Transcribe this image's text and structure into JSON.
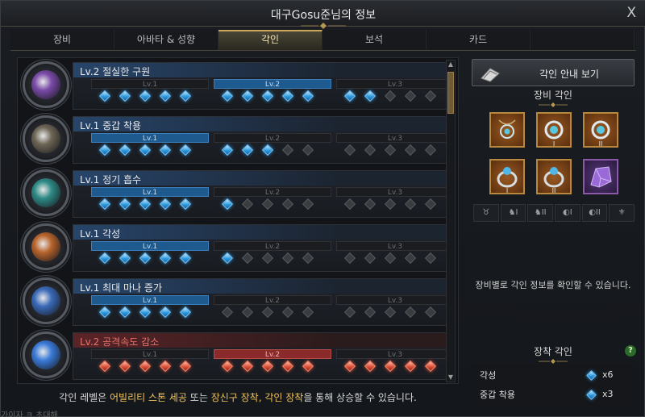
{
  "window": {
    "title": "대구Gosu준님의 정보",
    "close_label": "X"
  },
  "tabs": [
    {
      "label": "장비",
      "active": false
    },
    {
      "label": "아바타 & 성향",
      "active": false
    },
    {
      "label": "각인",
      "active": true
    },
    {
      "label": "보석",
      "active": false
    },
    {
      "label": "카드",
      "active": false
    },
    {
      "label": "",
      "active": false
    }
  ],
  "engravings": [
    {
      "name": "Lv.2 절실한 구원",
      "level": 2,
      "negative": false,
      "icon_color": "#7a4aa8",
      "gems": [
        5,
        5,
        2
      ]
    },
    {
      "name": "Lv.1 중갑 착용",
      "level": 1,
      "negative": false,
      "icon_color": "#6e6656",
      "gems": [
        5,
        3,
        0
      ]
    },
    {
      "name": "Lv.1 정기 흡수",
      "level": 1,
      "negative": false,
      "icon_color": "#2e8a86",
      "gems": [
        5,
        1,
        0
      ]
    },
    {
      "name": "Lv.1 각성",
      "level": 1,
      "negative": false,
      "icon_color": "#b8642c",
      "gems": [
        5,
        1,
        0
      ]
    },
    {
      "name": "Lv.1 최대 마나 증가",
      "level": 1,
      "negative": false,
      "icon_color": "#3a6ab8",
      "gems": [
        5,
        0,
        0
      ]
    },
    {
      "name": "Lv.2 공격속도 감소",
      "level": 2,
      "negative": true,
      "icon_color": "#3a7ad8",
      "gems": [
        5,
        5,
        5
      ]
    }
  ],
  "level_labels": [
    "Lv.1",
    "Lv.2",
    "Lv.3"
  ],
  "footer": {
    "prefix": "각인 레벨은 ",
    "h1": "어빌리티 스톤 세공",
    "mid": " 또는 ",
    "h2": "장신구 장착, 각인 장착",
    "suffix": "을 통해 상승할 수 있습니다."
  },
  "right": {
    "guide_button": "각인 안내 보기",
    "equip_title": "장비 각인",
    "info_text": "장비별로 각인 정보를 확인할 수 있습니다.",
    "equipped_title": "장착 각인",
    "help_label": "?",
    "slot_marks": [
      "",
      "I",
      "II",
      "I",
      "II",
      ""
    ],
    "type_slots": [
      "♉",
      "♞I",
      "♞II",
      "◐I",
      "◐II",
      "⚜"
    ],
    "equipped": [
      {
        "name": "각성",
        "count": "x6"
      },
      {
        "name": "중갑 착용",
        "count": "x3"
      }
    ]
  },
  "colors": {
    "accent_gold": "#f0c35a",
    "level_blue": "#1e5a8e",
    "level_red": "#8a2a2a"
  },
  "bg_text": "가이자 ㅋ 초대해"
}
